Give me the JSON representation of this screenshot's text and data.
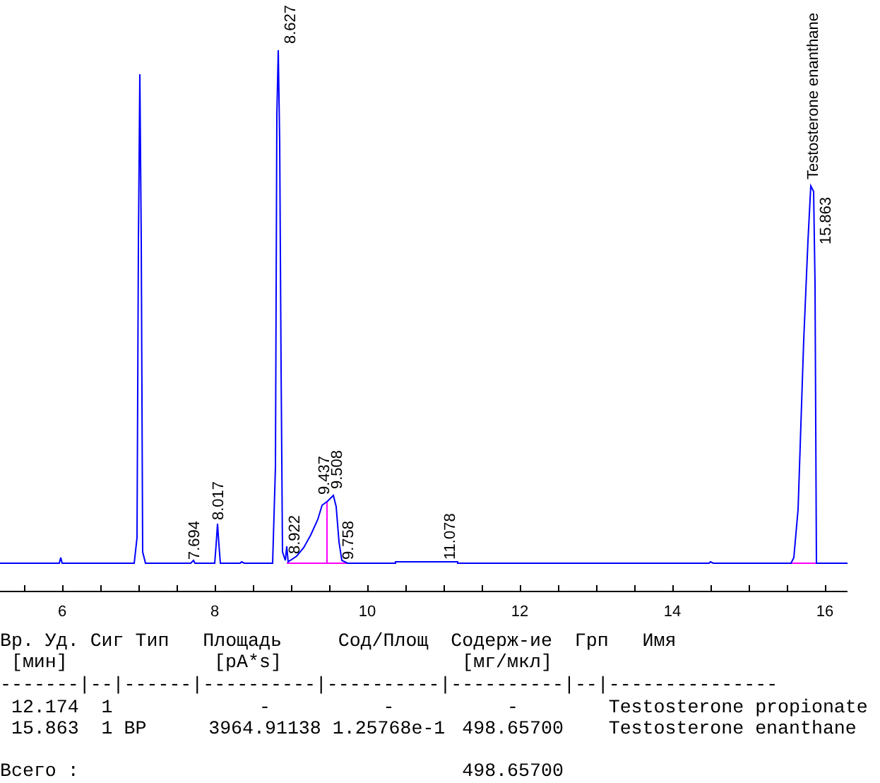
{
  "chromatogram": {
    "peak_labels": [
      {
        "text": "7.694"
      },
      {
        "text": "8.017"
      },
      {
        "text": "8.627"
      },
      {
        "text": "8.922"
      },
      {
        "text": "9.437"
      },
      {
        "text": "9.508"
      },
      {
        "text": "9.758"
      },
      {
        "text": "11.078"
      },
      {
        "text": "15.863"
      }
    ],
    "compound_label": "Testosterone enanthane",
    "x_axis_labels": [
      "6",
      "8",
      "10",
      "12",
      "14",
      "16"
    ]
  },
  "report": {
    "columns": [
      {
        "label": "Вр. Уд.",
        "unit": "[мин]"
      },
      {
        "label": "Сиг"
      },
      {
        "label": "Тип"
      },
      {
        "label": "Площадь",
        "unit": "[pA*s]"
      },
      {
        "label": "Сод/Площ"
      },
      {
        "label": "Содерж-ие",
        "unit": "[мг/мкл]"
      },
      {
        "label": "Грп"
      },
      {
        "label": "Имя"
      }
    ],
    "separator": "-------|--|------|----------|----------|----------|--|---------------",
    "rows": [
      {
        "ret_time": "12.174",
        "signal": "1",
        "area": "-",
        "amt_area": "-",
        "amount": "-",
        "name": "Testosterone propionate"
      },
      {
        "ret_time": "15.863",
        "signal": "1",
        "type": "BP",
        "area": "3964.91138",
        "amt_area": "1.25768e-1",
        "amount": "498.65700",
        "name": "Testosterone enanthane"
      }
    ],
    "total": {
      "label": "Всего :",
      "amount": "498.65700"
    }
  }
}
